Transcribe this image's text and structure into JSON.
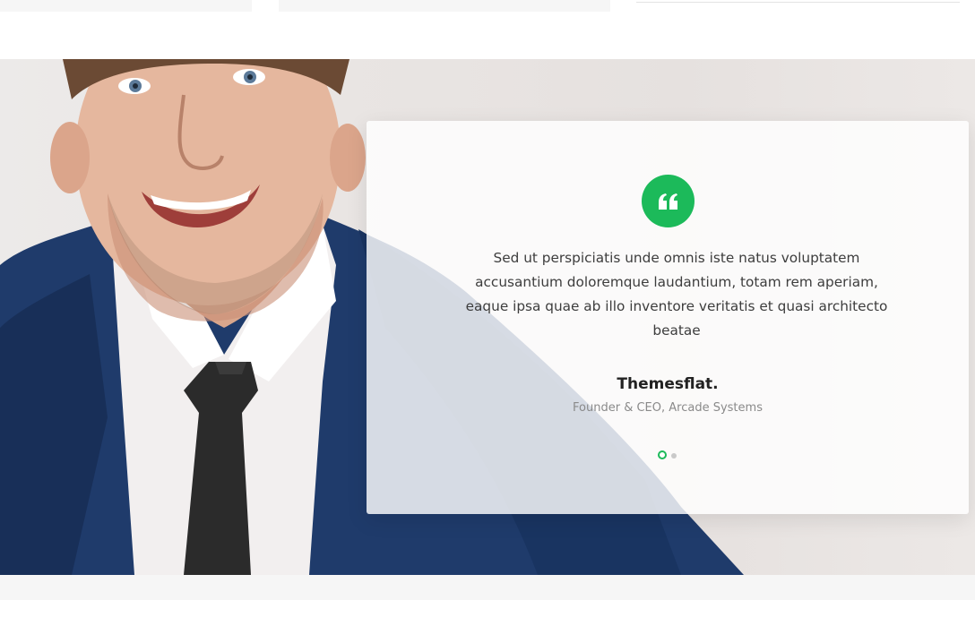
{
  "theme": {
    "accent": "#1cba5a",
    "text": "#3d3d3d",
    "heading": "#222222",
    "muted": "#8a8a8a"
  },
  "testimonial": {
    "quote_icon": "quote-left-icon",
    "quote": "Sed ut perspiciatis unde omnis iste natus voluptatem accusantium doloremque laudantium, totam rem aperiam, eaque ipsa quae ab illo inventore veritatis et quasi architecto beatae",
    "author_name": "Themesflat.",
    "author_role": "Founder & CEO, Arcade Systems",
    "slide_count": 2,
    "active_slide": 1
  }
}
